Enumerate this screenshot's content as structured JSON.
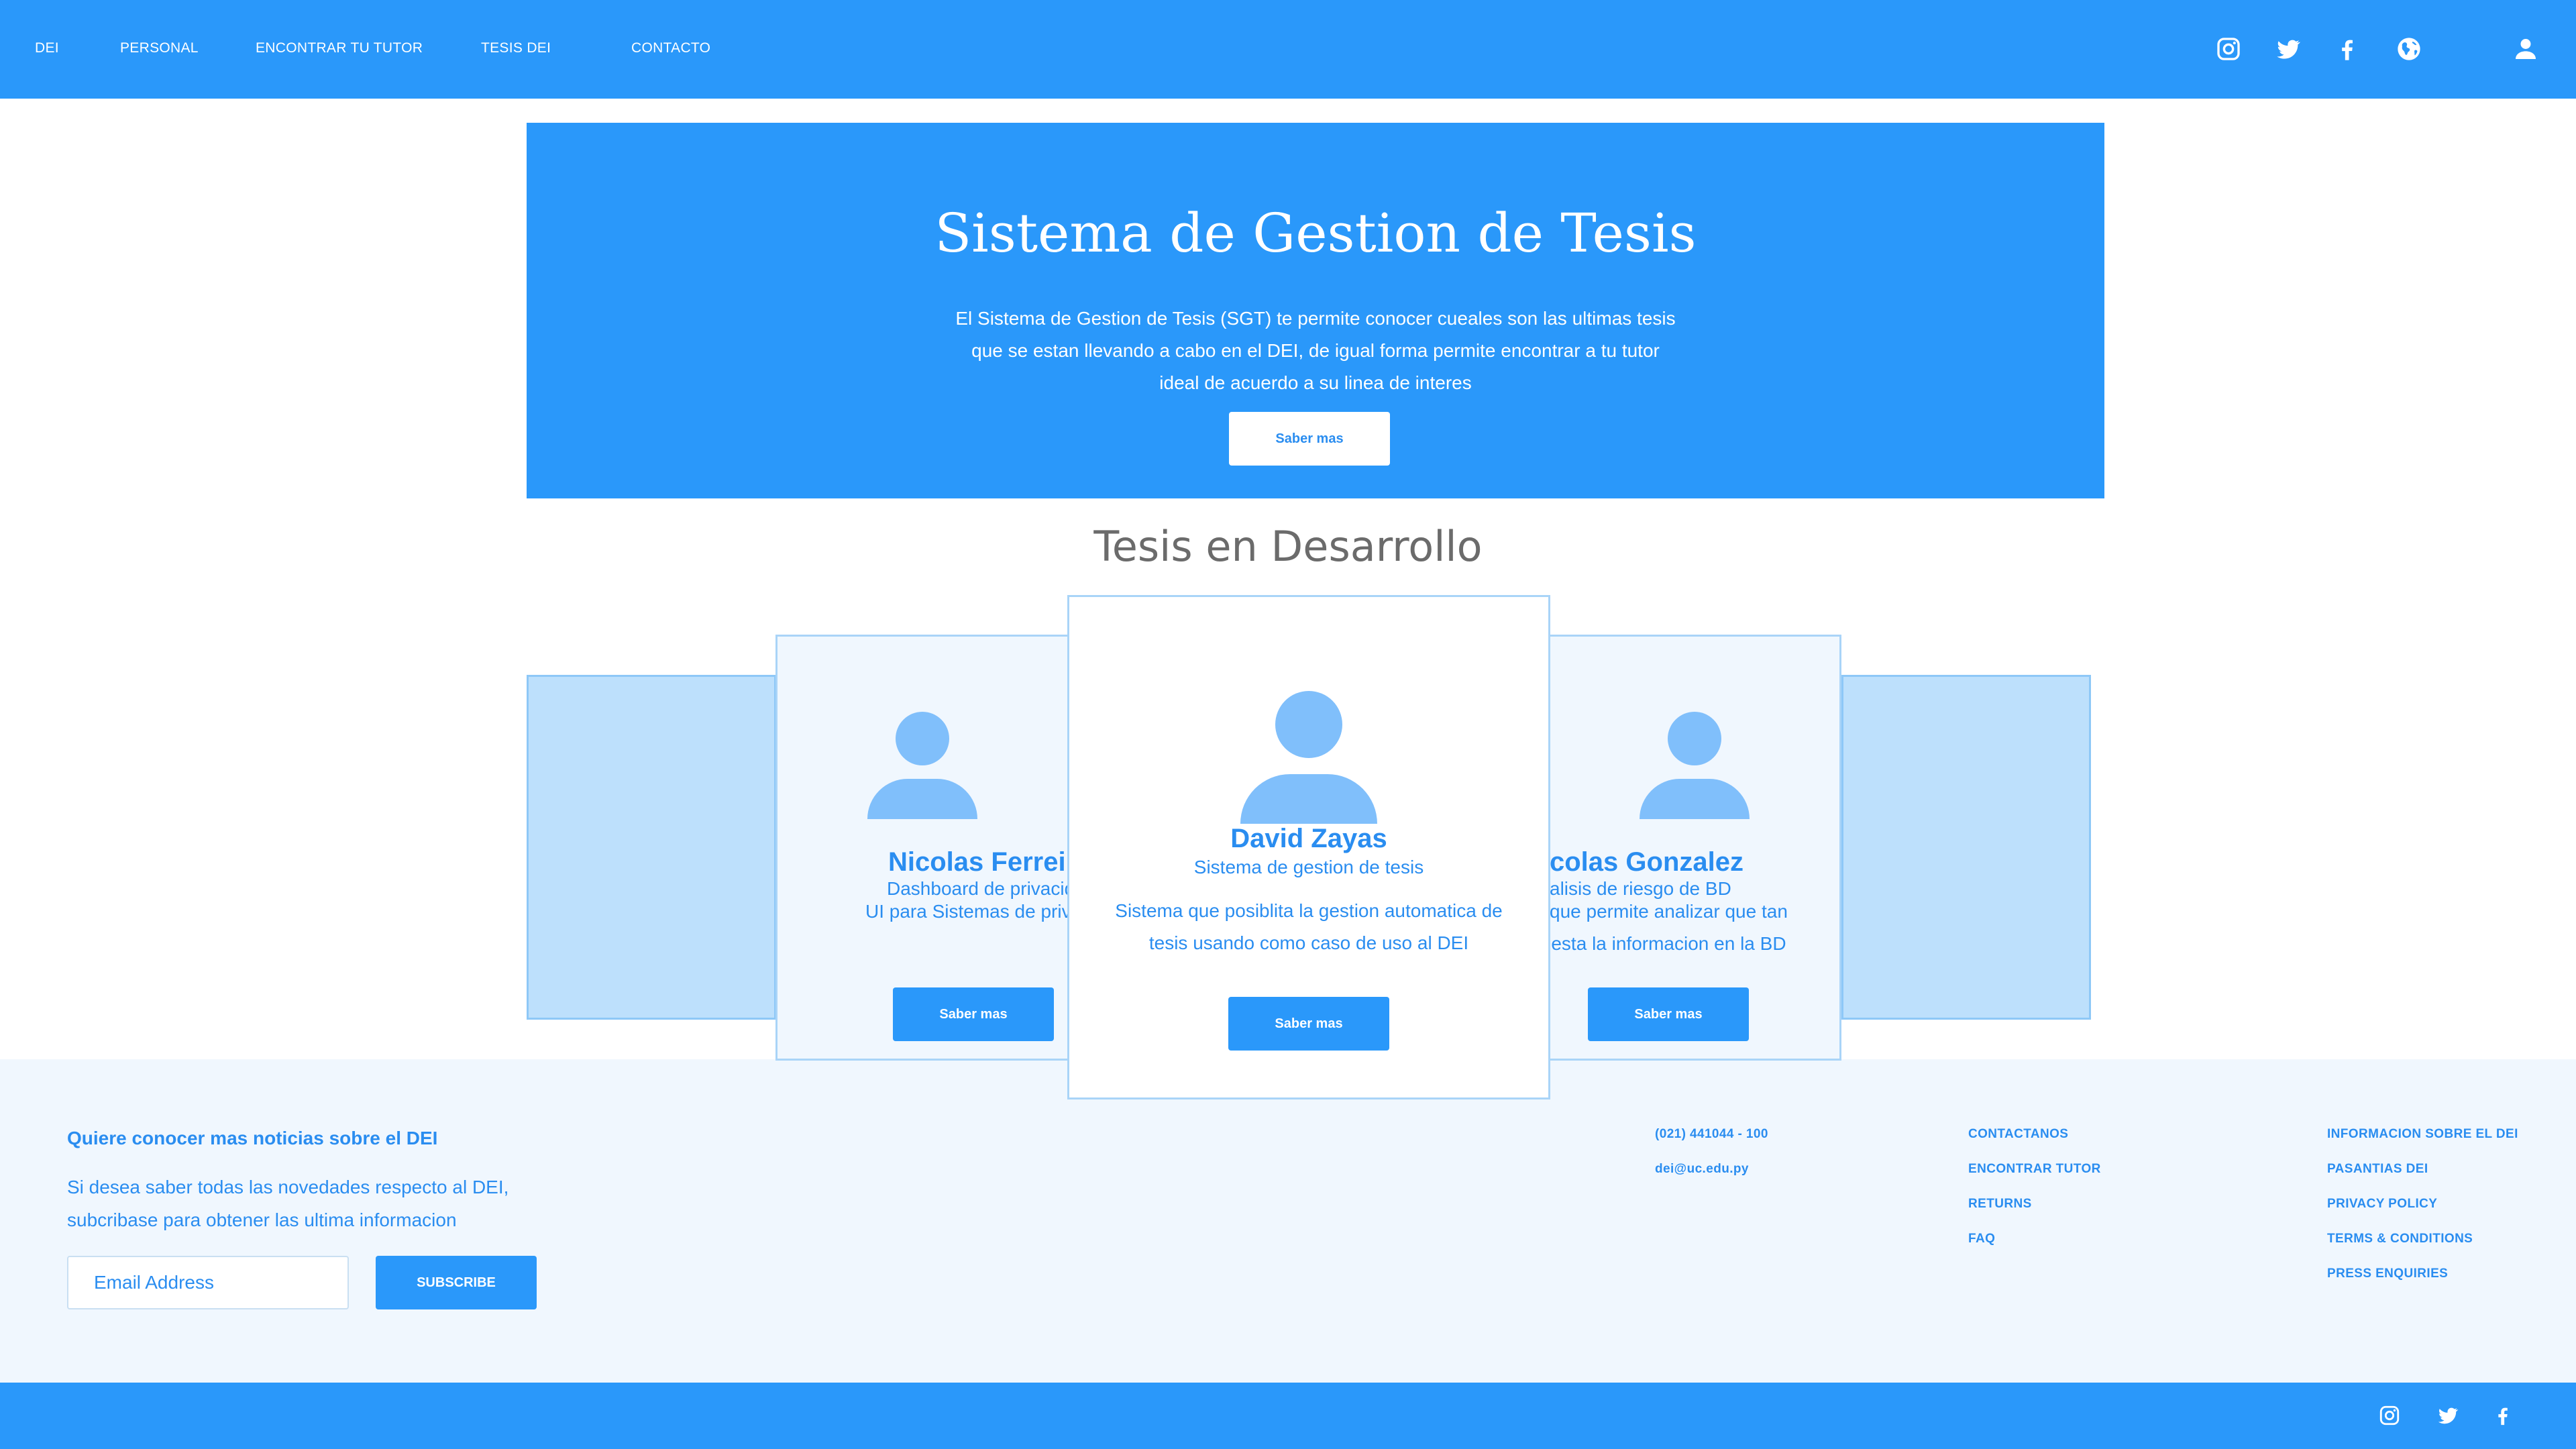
{
  "nav": {
    "links": [
      "DEI",
      "PERSONAL",
      "ENCONTRAR TU TUTOR",
      "TESIS DEI",
      "CONTACTO"
    ],
    "icons": [
      "instagram-icon",
      "twitter-icon",
      "facebook-icon",
      "globe-icon",
      "user-icon"
    ]
  },
  "hero": {
    "title": "Sistema de Gestion de Tesis",
    "description_lines": [
      "El Sistema de Gestion de Tesis (SGT) te permite conocer cueales son las ultimas tesis",
      "que se estan llevando a cabo en el DEI, de igual forma permite encontrar a tu tutor",
      "ideal de acuerdo a su linea de interes"
    ],
    "button": "Saber mas"
  },
  "section": {
    "title": "Tesis en Desarrollo"
  },
  "cards": [
    {
      "name": "Nicolas Ferrei",
      "subtitle": "Dashboard de privacid",
      "description_lines": [
        "UI para Sistemas de priv"
      ],
      "button": "Saber mas"
    },
    {
      "name": "David Zayas",
      "subtitle": "Sistema de gestion de tesis",
      "description_lines": [
        "Sistema que posiblita la gestion automatica de",
        "tesis usando como caso de uso al DEI"
      ],
      "button": "Saber mas"
    },
    {
      "name": "colas Gonzalez",
      "subtitle": "alisis de riesgo de BD",
      "description_lines": [
        "que permite analizar que tan",
        "esta la informacion en la BD"
      ],
      "button": "Saber mas"
    }
  ],
  "footer": {
    "heading": "Quiere conocer mas noticias sobre el DEI",
    "text_lines": [
      "Si desea saber todas las novedades respecto al DEI,",
      "subcribase para obtener las ultima informacion"
    ],
    "email_placeholder": "Email Address",
    "subscribe": "SUBSCRIBE",
    "contact": [
      "(021) 441044 - 100",
      "dei@uc.edu.py"
    ],
    "links_col1": [
      "CONTACTANOS",
      "ENCONTRAR TUTOR",
      "RETURNS",
      "FAQ"
    ],
    "links_col2": [
      "INFORMACION SOBRE EL DEI",
      "PASANTIAS DEI",
      "PRIVACY POLICY",
      "TERMS & CONDITIONS",
      "PRESS ENQUIRIES"
    ]
  },
  "bottom_bar": {
    "icons": [
      "instagram-icon",
      "twitter-icon",
      "facebook-icon"
    ]
  },
  "colors": {
    "primary": "#2a98fa",
    "text_blue": "#2a8df0",
    "light_bg": "#f0f7fe",
    "avatar": "#80bffb",
    "side_slide": "#bde0fc"
  }
}
